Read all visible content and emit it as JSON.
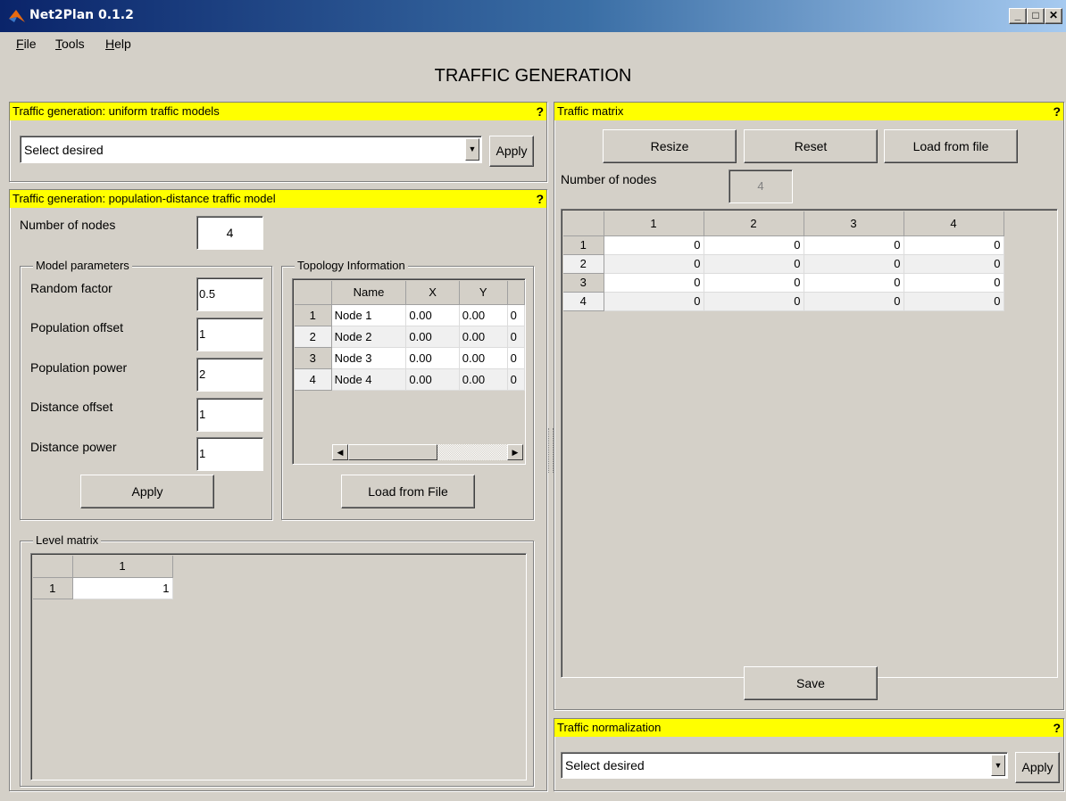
{
  "window": {
    "title": "Net2Plan 0.1.2",
    "minimize_label": "_",
    "maximize_label": "□",
    "close_label": "✕"
  },
  "menu": [
    {
      "label": "File",
      "underline": "F",
      "rest": "ile"
    },
    {
      "label": "Tools",
      "underline": "T",
      "rest": "ools"
    },
    {
      "label": "Help",
      "underline": "H",
      "rest": "elp"
    }
  ],
  "page_title": "TRAFFIC GENERATION",
  "help_mark": "?",
  "uniform_panel": {
    "title": "Traffic generation: uniform traffic models",
    "select_value": "Select desired",
    "apply_label": "Apply"
  },
  "popdist_panel": {
    "title": "Traffic generation: population-distance traffic model",
    "nodes_label": "Number of nodes",
    "nodes_value": "4",
    "model_params": {
      "legend": "Model parameters",
      "random_factor_label": "Random factor",
      "random_factor_value": "0.5",
      "population_offset_label": "Population offset",
      "population_offset_value": "1",
      "population_power_label": "Population power",
      "population_power_value": "2",
      "distance_offset_label": "Distance offset",
      "distance_offset_value": "1",
      "distance_power_label": "Distance power",
      "distance_power_value": "1",
      "apply_label": "Apply"
    },
    "topology": {
      "legend": "Topology Information",
      "columns": [
        "Name",
        "X",
        "Y"
      ],
      "rows": [
        {
          "idx": "1",
          "name": "Node 1",
          "x": "0.00",
          "y": "0.00",
          "extra": "0"
        },
        {
          "idx": "2",
          "name": "Node 2",
          "x": "0.00",
          "y": "0.00",
          "extra": "0"
        },
        {
          "idx": "3",
          "name": "Node 3",
          "x": "0.00",
          "y": "0.00",
          "extra": "0"
        },
        {
          "idx": "4",
          "name": "Node 4",
          "x": "0.00",
          "y": "0.00",
          "extra": "0"
        }
      ],
      "load_label": "Load from File"
    },
    "level_matrix": {
      "legend": "Level matrix",
      "column": "1",
      "row_index": "1",
      "value": "1"
    }
  },
  "traffic_matrix": {
    "title": "Traffic matrix",
    "resize_label": "Resize",
    "reset_label": "Reset",
    "load_label": "Load from file",
    "nodes_label": "Number of nodes",
    "nodes_value": "4",
    "columns": [
      "1",
      "2",
      "3",
      "4"
    ],
    "rows": [
      {
        "idx": "1",
        "values": [
          "0",
          "0",
          "0",
          "0"
        ]
      },
      {
        "idx": "2",
        "values": [
          "0",
          "0",
          "0",
          "0"
        ]
      },
      {
        "idx": "3",
        "values": [
          "0",
          "0",
          "0",
          "0"
        ]
      },
      {
        "idx": "4",
        "values": [
          "0",
          "0",
          "0",
          "0"
        ]
      }
    ],
    "save_label": "Save"
  },
  "normalization": {
    "title": "Traffic normalization",
    "select_value": "Select desired",
    "apply_label": "Apply"
  }
}
